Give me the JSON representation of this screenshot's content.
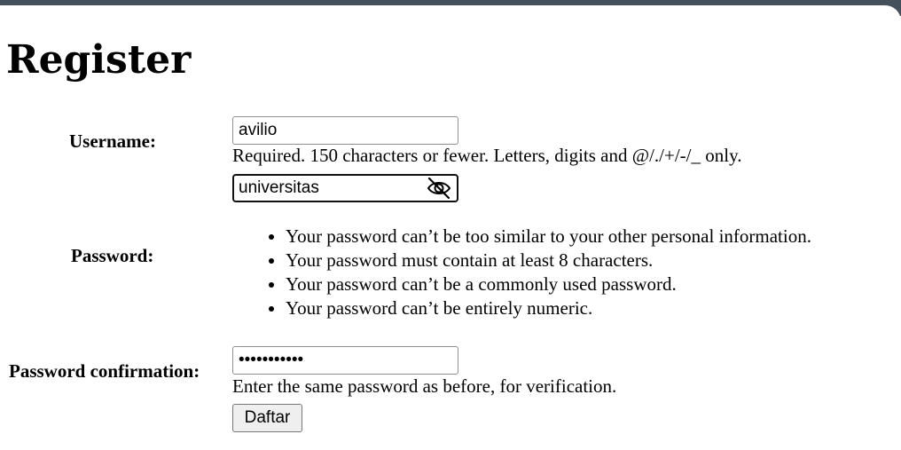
{
  "page": {
    "title": "Register"
  },
  "form": {
    "username": {
      "label": "Username:",
      "value": "avilio",
      "help": "Required. 150 characters or fewer. Letters, digits and @/./+/-/_ only."
    },
    "password": {
      "label": "Password:",
      "value": "universitas",
      "toggle_icon": "eye-off-icon",
      "rules": [
        "Your password can’t be too similar to your other personal information.",
        "Your password must contain at least 8 characters.",
        "Your password can’t be a commonly used password.",
        "Your password can’t be entirely numeric."
      ]
    },
    "password_confirmation": {
      "label": "Password confirmation:",
      "masked_value": "•••••••••••",
      "help": "Enter the same password as before, for verification."
    },
    "submit": {
      "label": "Daftar"
    }
  },
  "colors": {
    "top_bar": "#44505c",
    "input_border": "#8f8f8f",
    "focused_input_border": "#101010",
    "button_bg": "#efefef"
  }
}
